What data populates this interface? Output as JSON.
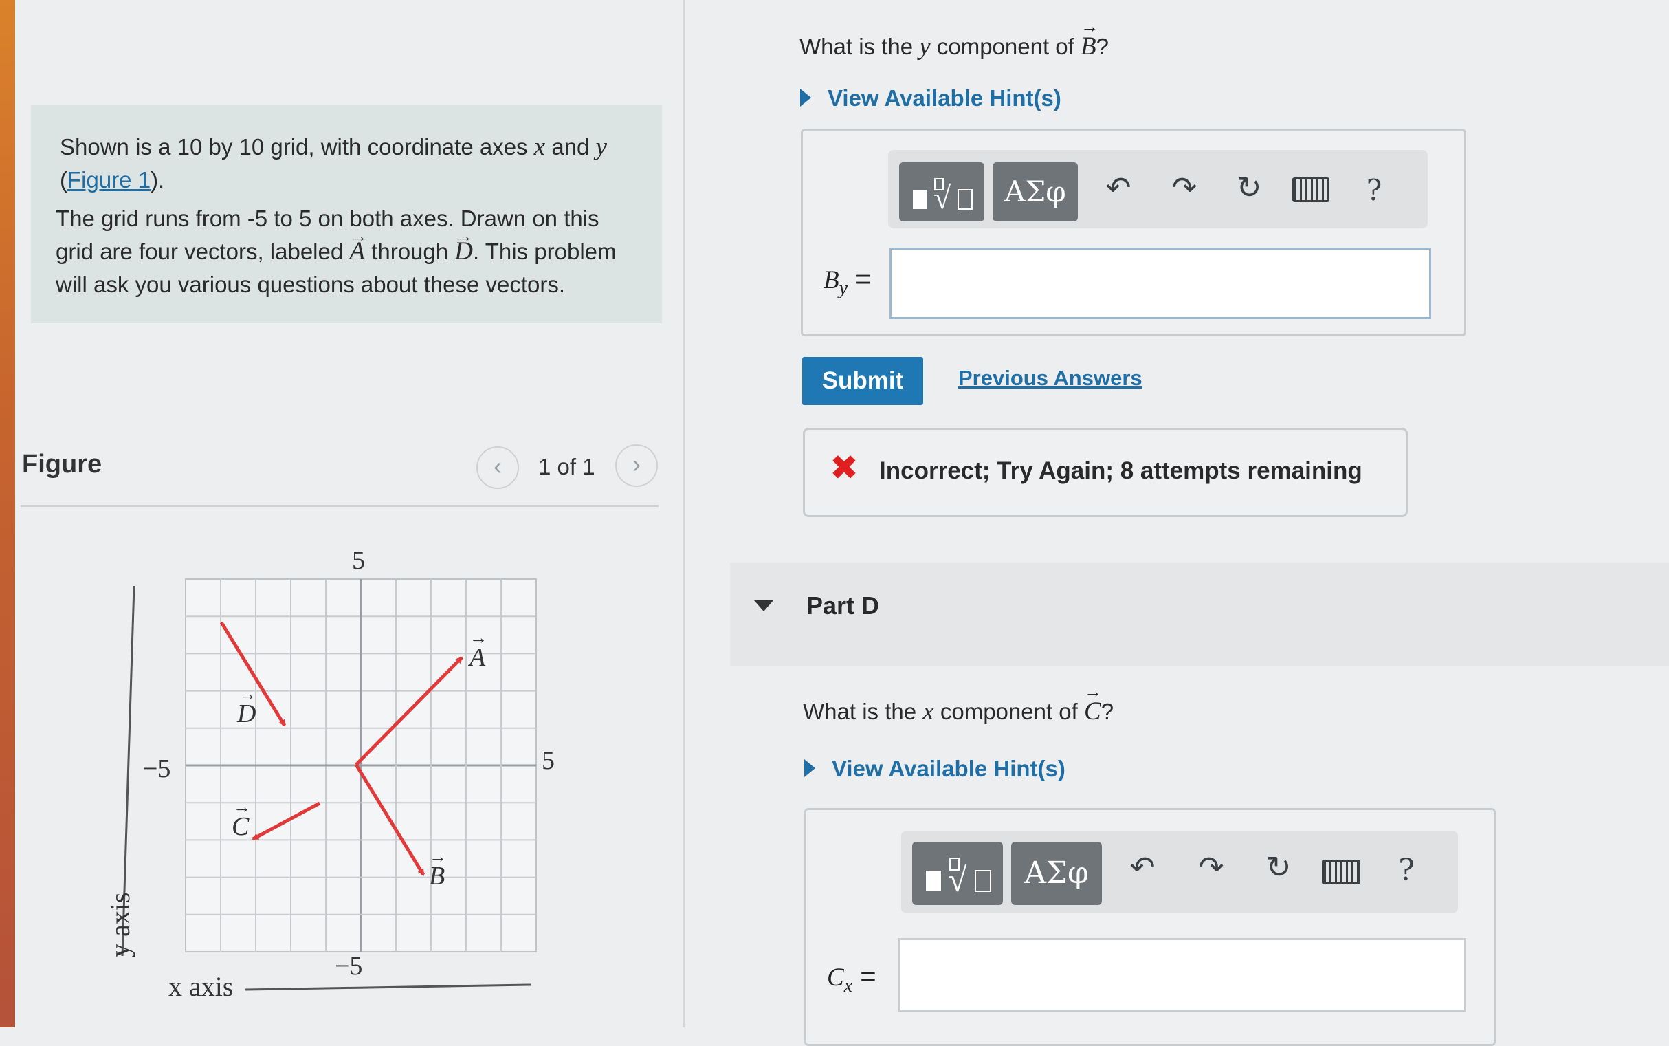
{
  "intro": {
    "para1_pre": "Shown is a 10 by 10 grid, with coordinate axes",
    "axis_x": "x",
    "and": "and",
    "axis_y": "y",
    "fig_link": "Figure 1",
    "para2_line1": "The grid runs from -5 to 5 on both axes. Drawn on this",
    "para2_line2_pre": "grid are four vectors, labeled",
    "vec_A": "A",
    "through": "through",
    "vec_D": "D",
    "para2_line2_post": ". This problem",
    "para2_line3": "will ask you various questions about these vectors."
  },
  "figure": {
    "title": "Figure",
    "pager": "1 of 1",
    "prev_icon": "chevron-left-icon",
    "next_icon": "chevron-right-icon",
    "top_tick": "5",
    "left_tick": "−5",
    "right_tick": "5",
    "bottom_tick": "−5",
    "x_axis_label": "x axis",
    "y_axis_label": "y axis",
    "vector_labels": [
      "A",
      "B",
      "C",
      "D"
    ],
    "vector_color": "#e23a3a"
  },
  "partC": {
    "question_pre": "What is the",
    "question_var": "y",
    "question_mid": "component of",
    "question_vec": "B",
    "question_post": "?",
    "hint": "View Available Hint(s)",
    "input_label_main": "B",
    "input_label_sub": "y",
    "equals": "=",
    "input_value": "",
    "greek": "ΑΣφ",
    "help": "?",
    "submit": "Submit",
    "previous_answers": "Previous Answers",
    "feedback": "Incorrect; Try Again; 8 attempts remaining"
  },
  "partD": {
    "label": "Part D",
    "question_pre": "What is the",
    "question_var": "x",
    "question_mid": "component of",
    "question_vec": "C",
    "question_post": "?",
    "hint": "View Available Hint(s)",
    "input_label_main": "C",
    "input_label_sub": "x",
    "equals": "=",
    "input_value": "",
    "greek": "ΑΣφ",
    "help": "?"
  }
}
